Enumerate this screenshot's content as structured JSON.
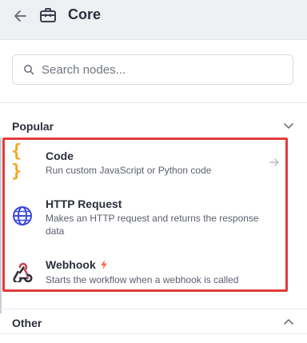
{
  "header": {
    "title": "Core"
  },
  "search": {
    "placeholder": "Search nodes..."
  },
  "sections": {
    "popular": {
      "title": "Popular",
      "nodes": [
        {
          "title": "Code",
          "description": "Run custom JavaScript or Python code",
          "icon": "code-braces-icon"
        },
        {
          "title": "HTTP Request",
          "description": "Makes an HTTP request and returns the response data",
          "icon": "globe-icon"
        },
        {
          "title": "Webhook",
          "description": "Starts the workflow when a webhook is called",
          "icon": "webhook-icon"
        }
      ]
    },
    "other": {
      "title": "Other"
    }
  },
  "colors": {
    "header_bg": "#eef0f4",
    "highlight": "#e23b3b",
    "code_icon": "#f5a623",
    "globe_icon": "#3a49d9",
    "bolt": "#ff6d5a",
    "webhook_dark": "#2f2f3a",
    "webhook_red": "#c94a5a"
  },
  "code_icon_glyph": "{ }"
}
